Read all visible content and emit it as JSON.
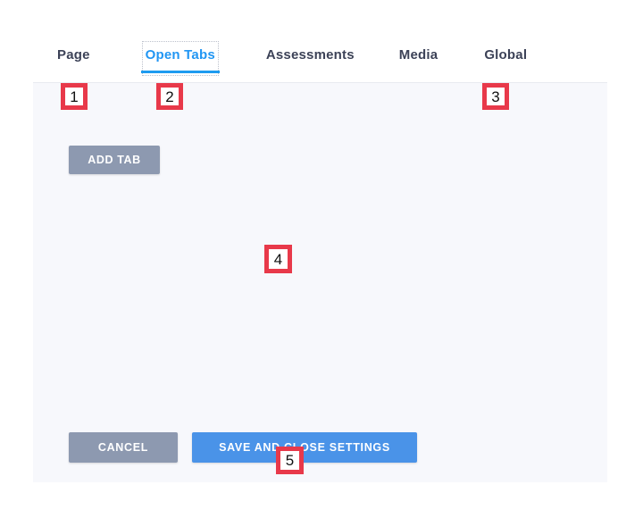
{
  "panel": {
    "background_color": "#f7f8fc",
    "tab_bar_background_color": "#ffffff"
  },
  "tabs": {
    "active_index": 1,
    "active_color": "#2196f3",
    "inactive_color": "#3c4257",
    "items": [
      {
        "id": "page",
        "label": "Page",
        "active": false
      },
      {
        "id": "open-tabs",
        "label": "Open Tabs",
        "active": true
      },
      {
        "id": "assessments",
        "label": "Assessments",
        "active": false
      },
      {
        "id": "media",
        "label": "Media",
        "active": false
      },
      {
        "id": "global",
        "label": "Global",
        "active": false
      }
    ]
  },
  "toolbar": {
    "add_tab_label": "ADD TAB",
    "add_tab_color": "#8d99b0"
  },
  "content": {
    "empty": true,
    "empty_text": ""
  },
  "footer": {
    "cancel_label": "CANCEL",
    "cancel_color": "#8d99b0",
    "save_label": "SAVE AND CLOSE SETTINGS",
    "save_color": "#4a93e8"
  },
  "annotations": {
    "border_color": "#e8394a",
    "markers": [
      {
        "id": 1,
        "label": "1",
        "target": "tab-page"
      },
      {
        "id": 2,
        "label": "2",
        "target": "tab-open-tabs"
      },
      {
        "id": 3,
        "label": "3",
        "target": "tab-global"
      },
      {
        "id": 4,
        "label": "4",
        "target": "panel-body"
      },
      {
        "id": 5,
        "label": "5",
        "target": "save-close-button"
      }
    ]
  }
}
